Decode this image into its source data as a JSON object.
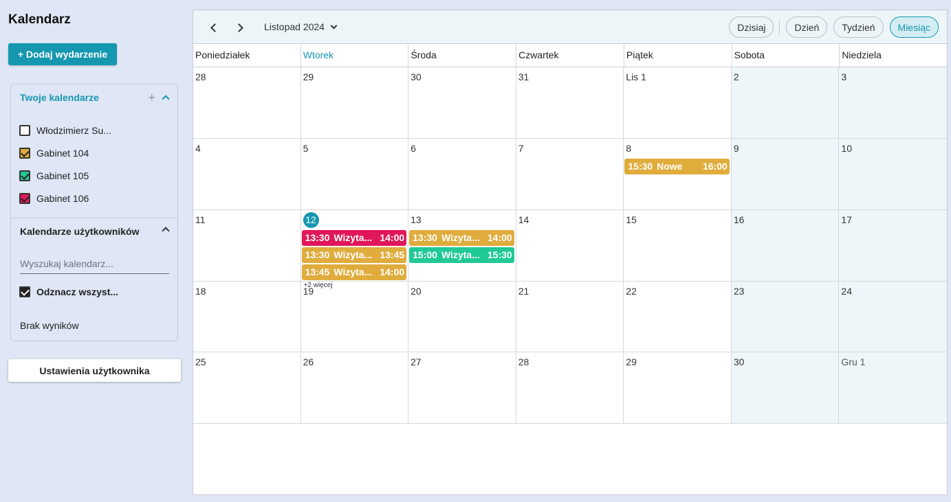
{
  "app_title": "Kalendarz",
  "add_event_label": "+ Dodaj wydarzenie",
  "your_calendars": {
    "title": "Twoje kalendarze",
    "items": [
      {
        "label": "Włodzimierz Su...",
        "checked": false,
        "color": "#ffffff"
      },
      {
        "label": "Gabinet 104",
        "checked": true,
        "color": "#e0ac3c"
      },
      {
        "label": "Gabinet 105",
        "checked": true,
        "color": "#21c997"
      },
      {
        "label": "Gabinet 106",
        "checked": true,
        "color": "#e01759"
      }
    ]
  },
  "user_calendars": {
    "title": "Kalendarze użytkowników",
    "search_placeholder": "Wyszukaj kalendarz...",
    "select_all_label": "Odznacz wszyst...",
    "no_results": "Brak wyników"
  },
  "settings_label": "Ustawienia użytkownika",
  "toolbar": {
    "month_label": "Listopad 2024",
    "today_label": "Dzisiaj",
    "views": [
      "Dzień",
      "Tydzień",
      "Miesiąc"
    ],
    "active_view": "Miesiąc"
  },
  "weekdays": [
    "Poniedziałek",
    "Wtorek",
    "Środa",
    "Czwartek",
    "Piątek",
    "Sobota",
    "Niedziela"
  ],
  "today_weekday_index": 1,
  "colors": {
    "accent": "#1597b0",
    "gabinet_104": "#e0ac3c",
    "gabinet_105": "#21c997",
    "gabinet_106": "#e01759"
  },
  "days": [
    {
      "label": "28"
    },
    {
      "label": "29"
    },
    {
      "label": "30"
    },
    {
      "label": "31"
    },
    {
      "label": "Lis 1"
    },
    {
      "label": "2"
    },
    {
      "label": "3"
    },
    {
      "label": "4"
    },
    {
      "label": "5"
    },
    {
      "label": "6"
    },
    {
      "label": "7"
    },
    {
      "label": "8",
      "events": [
        {
          "start": "15:30",
          "title": "Nowe",
          "end": "16:00",
          "color": "#e0ac3c"
        }
      ]
    },
    {
      "label": "9"
    },
    {
      "label": "10"
    },
    {
      "label": "11"
    },
    {
      "label": "12",
      "today": true,
      "events": [
        {
          "start": "13:30",
          "title": "Wizyta...",
          "end": "14:00",
          "color": "#e01759"
        },
        {
          "start": "13:30",
          "title": "Wizyta...",
          "end": "13:45",
          "color": "#e0ac3c"
        },
        {
          "start": "13:45",
          "title": "Wizyta...",
          "end": "14:00",
          "color": "#e0ac3c"
        }
      ],
      "more": "+2 więcej"
    },
    {
      "label": "13",
      "events": [
        {
          "start": "13:30",
          "title": "Wizyta...",
          "end": "14:00",
          "color": "#e0ac3c"
        },
        {
          "start": "15:00",
          "title": "Wizyta...",
          "end": "15:30",
          "color": "#21c997"
        }
      ]
    },
    {
      "label": "14"
    },
    {
      "label": "15"
    },
    {
      "label": "16"
    },
    {
      "label": "17"
    },
    {
      "label": "18"
    },
    {
      "label": "19"
    },
    {
      "label": "20"
    },
    {
      "label": "21"
    },
    {
      "label": "22"
    },
    {
      "label": "23"
    },
    {
      "label": "24"
    },
    {
      "label": "25"
    },
    {
      "label": "26"
    },
    {
      "label": "27"
    },
    {
      "label": "28"
    },
    {
      "label": "29"
    },
    {
      "label": "30"
    },
    {
      "label": "Gru 1",
      "other": true
    }
  ]
}
